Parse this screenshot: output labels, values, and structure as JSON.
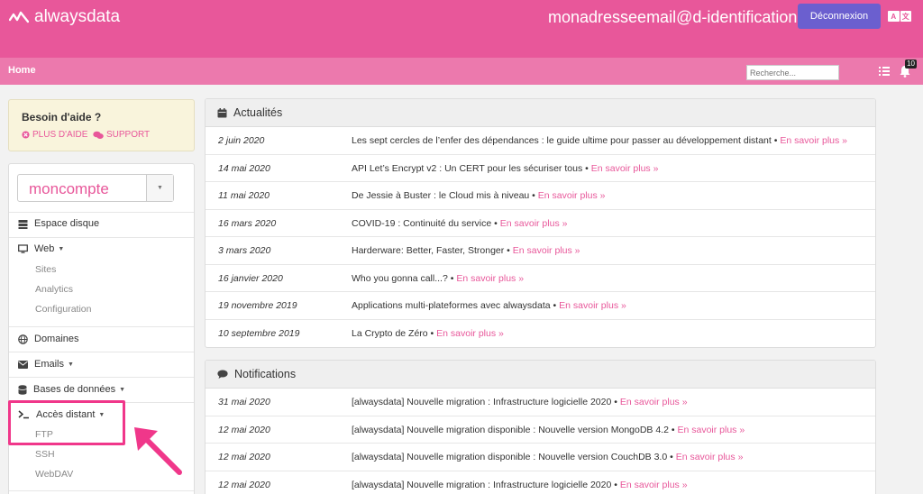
{
  "header": {
    "logo_text": "alwaysdata",
    "user_email": "monadresseemail@d-identification",
    "logout_label": "Déconnexion",
    "lang_left": "A",
    "lang_right": "文"
  },
  "nav": {
    "home": "Home",
    "search_placeholder": "Recherche...",
    "notification_count": "10"
  },
  "help": {
    "title": "Besoin d'aide ?",
    "more_help": "PLUS D'AIDE",
    "support": "SUPPORT"
  },
  "sidebar": {
    "account": "moncompte",
    "items": {
      "disk": "Espace disque",
      "web": "Web",
      "web_sites": "Sites",
      "web_analytics": "Analytics",
      "web_config": "Configuration",
      "domains": "Domaines",
      "emails": "Emails",
      "databases": "Bases de données",
      "remote": "Accès distant",
      "remote_ftp": "FTP",
      "remote_ssh": "SSH",
      "remote_webdav": "WebDAV"
    }
  },
  "news": {
    "title": "Actualités",
    "more_label": "En savoir plus »",
    "rows": [
      {
        "date": "2 juin 2020",
        "title": "Les sept cercles de l’enfer des dépendances : le guide ultime pour passer au développement distant"
      },
      {
        "date": "14 mai 2020",
        "title": "API Let’s Encrypt v2 : Un CERT pour les sécuriser tous"
      },
      {
        "date": "11 mai 2020",
        "title": "De Jessie à Buster : le Cloud mis à niveau"
      },
      {
        "date": "16 mars 2020",
        "title": "COVID-19 : Continuité du service"
      },
      {
        "date": "3 mars 2020",
        "title": "Harderware: Better, Faster, Stronger"
      },
      {
        "date": "16 janvier 2020",
        "title": "Who you gonna call...?"
      },
      {
        "date": "19 novembre 2019",
        "title": "Applications multi-plateformes avec alwaysdata"
      },
      {
        "date": "10 septembre 2019",
        "title": "La Crypto de Zéro"
      }
    ]
  },
  "notifications": {
    "title": "Notifications",
    "more_label": "En savoir plus »",
    "rows": [
      {
        "date": "31 mai 2020",
        "title": "[alwaysdata] Nouvelle migration : Infrastructure logicielle 2020"
      },
      {
        "date": "12 mai 2020",
        "title": "[alwaysdata] Nouvelle migration disponible : Nouvelle version MongoDB 4.2"
      },
      {
        "date": "12 mai 2020",
        "title": "[alwaysdata] Nouvelle migration disponible : Nouvelle version CouchDB 3.0"
      },
      {
        "date": "12 mai 2020",
        "title": "[alwaysdata] Nouvelle migration : Infrastructure logicielle 2020"
      }
    ]
  },
  "colors": {
    "brand_pink": "#e8579a",
    "nav_pink": "#ec79ad",
    "logout_purple": "#6b5fcf",
    "highlight": "#f0378a"
  }
}
